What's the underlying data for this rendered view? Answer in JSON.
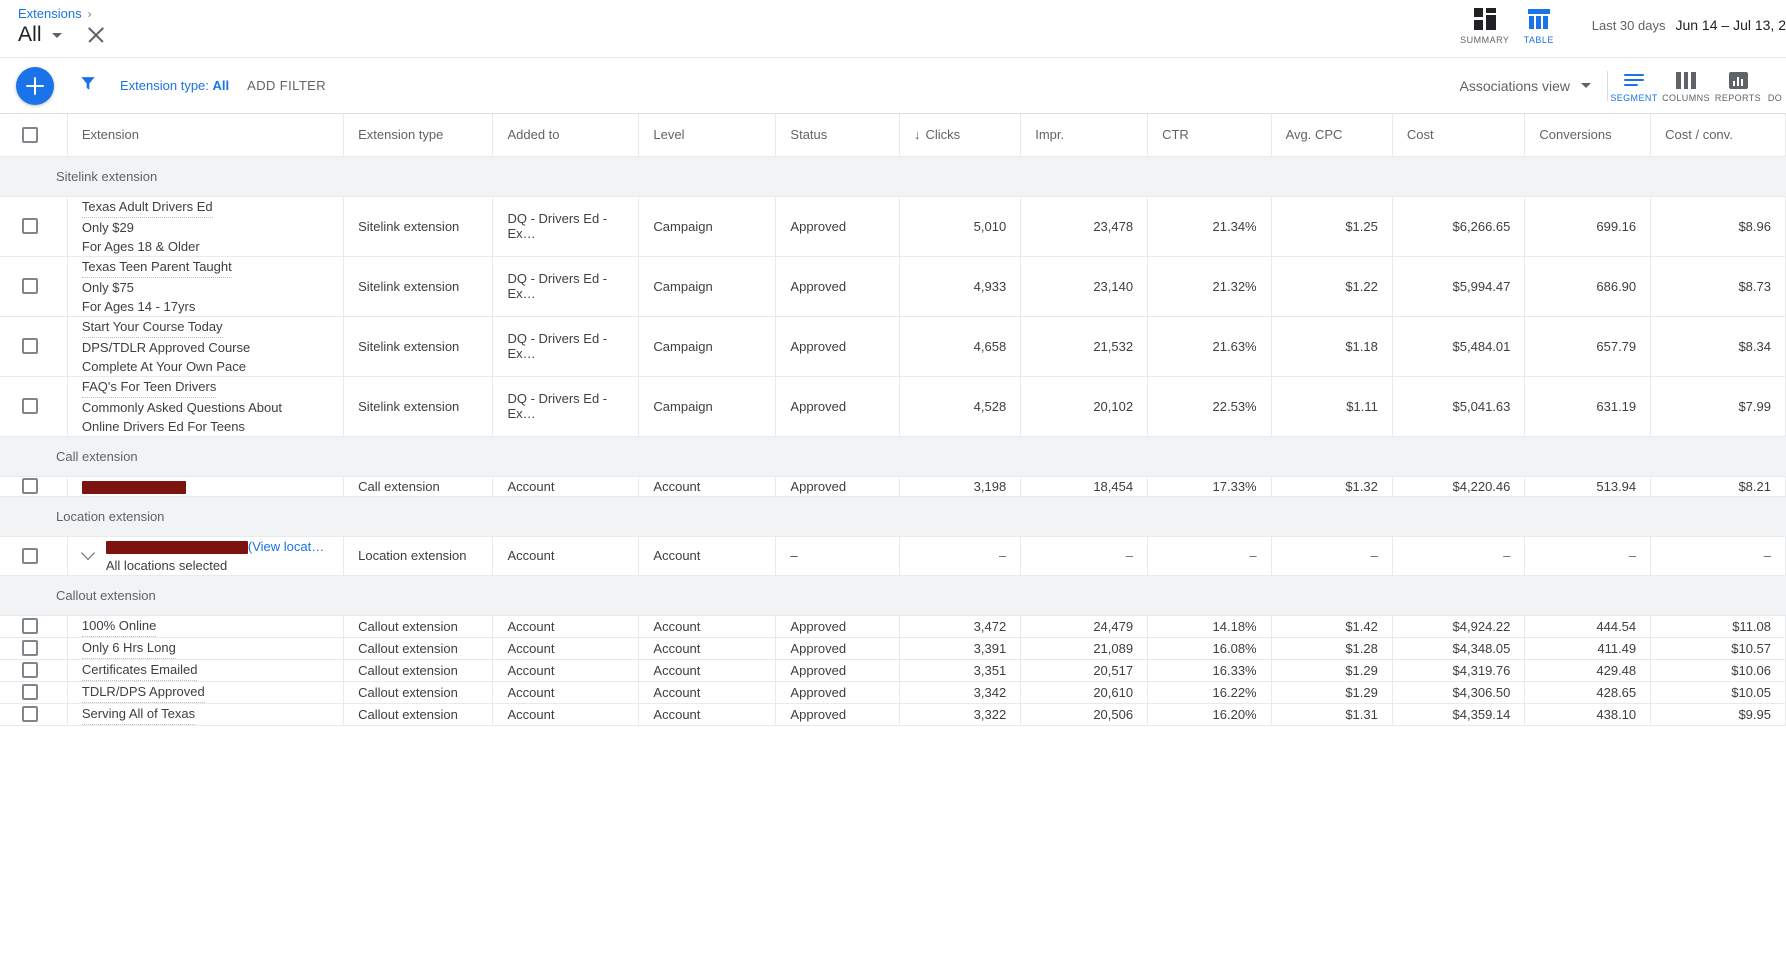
{
  "header": {
    "breadcrumb_link": "Extensions",
    "breadcrumb_separator": "›",
    "scope_label": "All",
    "close_icon": "close-icon",
    "views": [
      {
        "label": "SUMMARY",
        "icon": "summary-grid-icon",
        "active": false
      },
      {
        "label": "TABLE",
        "icon": "table-columns-icon",
        "active": true
      }
    ],
    "date_preset": "Last 30 days",
    "date_value": "Jun 14 – Jul 13, 2"
  },
  "filterbar": {
    "add_button_icon": "plus-icon",
    "filter_icon": "funnel-icon",
    "filter_chip_prefix": "Extension type:",
    "filter_chip_value": "All",
    "add_filter_label": "ADD FILTER",
    "associations_view_label": "Associations view",
    "tools": [
      {
        "label": "SEGMENT",
        "icon": "segment-lines-icon",
        "active": true
      },
      {
        "label": "COLUMNS",
        "icon": "columns-icon",
        "active": false
      },
      {
        "label": "REPORTS",
        "icon": "reports-bar-icon",
        "active": false
      },
      {
        "label": "DO",
        "icon": "download-icon",
        "active": false
      }
    ]
  },
  "table": {
    "select_all_icon": "checkbox-icon",
    "columns": [
      "Extension",
      "Extension type",
      "Added to",
      "Level",
      "Status",
      "Clicks",
      "Impr.",
      "CTR",
      "Avg. CPC",
      "Cost",
      "Conversions",
      "Cost / conv."
    ],
    "sort_column": "Clicks",
    "sort_arrow": "↓",
    "groups": [
      {
        "title": "Sitelink extension",
        "rows": [
          {
            "lines": [
              "Texas Adult Drivers Ed",
              "Only $29",
              "For Ages 18 & Older"
            ],
            "type": "Sitelink extension",
            "added_to": "DQ - Drivers Ed - Ex…",
            "level": "Campaign",
            "status": "Approved",
            "clicks": "5,010",
            "impr": "23,478",
            "ctr": "21.34%",
            "avg_cpc": "$1.25",
            "cost": "$6,266.65",
            "conversions": "699.16",
            "cost_conv": "$8.96"
          },
          {
            "lines": [
              "Texas Teen Parent Taught",
              "Only $75",
              "For Ages 14 - 17yrs"
            ],
            "type": "Sitelink extension",
            "added_to": "DQ - Drivers Ed - Ex…",
            "level": "Campaign",
            "status": "Approved",
            "clicks": "4,933",
            "impr": "23,140",
            "ctr": "21.32%",
            "avg_cpc": "$1.22",
            "cost": "$5,994.47",
            "conversions": "686.90",
            "cost_conv": "$8.73"
          },
          {
            "lines": [
              "Start Your Course Today",
              "DPS/TDLR Approved Course",
              "Complete At Your Own Pace"
            ],
            "type": "Sitelink extension",
            "added_to": "DQ - Drivers Ed - Ex…",
            "level": "Campaign",
            "status": "Approved",
            "clicks": "4,658",
            "impr": "21,532",
            "ctr": "21.63%",
            "avg_cpc": "$1.18",
            "cost": "$5,484.01",
            "conversions": "657.79",
            "cost_conv": "$8.34"
          },
          {
            "lines": [
              "FAQ's For Teen Drivers",
              "Commonly Asked Questions About",
              "Online Drivers Ed For Teens"
            ],
            "type": "Sitelink extension",
            "added_to": "DQ - Drivers Ed - Ex…",
            "level": "Campaign",
            "status": "Approved",
            "clicks": "4,528",
            "impr": "20,102",
            "ctr": "22.53%",
            "avg_cpc": "$1.11",
            "cost": "$5,041.63",
            "conversions": "631.19",
            "cost_conv": "$7.99"
          }
        ]
      },
      {
        "title": "Call extension",
        "rows": [
          {
            "redacted": "phone",
            "lines": [
              ""
            ],
            "type": "Call extension",
            "added_to": "Account",
            "level": "Account",
            "status": "Approved",
            "clicks": "3,198",
            "impr": "18,454",
            "ctr": "17.33%",
            "avg_cpc": "$1.32",
            "cost": "$4,220.46",
            "conversions": "513.94",
            "cost_conv": "$8.21"
          }
        ]
      },
      {
        "title": "Location extension",
        "rows": [
          {
            "redacted": "location",
            "expander_icon": "chevron-down-icon",
            "link_text": "(View locat…",
            "sub_text": "All locations selected",
            "lines": [
              ""
            ],
            "type": "Location extension",
            "added_to": "Account",
            "level": "Account",
            "status": "–",
            "clicks": "–",
            "impr": "–",
            "ctr": "–",
            "avg_cpc": "–",
            "cost": "–",
            "conversions": "–",
            "cost_conv": "–"
          }
        ]
      },
      {
        "title": "Callout extension",
        "rows": [
          {
            "lines": [
              "100% Online"
            ],
            "type": "Callout extension",
            "added_to": "Account",
            "level": "Account",
            "status": "Approved",
            "clicks": "3,472",
            "impr": "24,479",
            "ctr": "14.18%",
            "avg_cpc": "$1.42",
            "cost": "$4,924.22",
            "conversions": "444.54",
            "cost_conv": "$11.08"
          },
          {
            "lines": [
              "Only 6 Hrs Long"
            ],
            "type": "Callout extension",
            "added_to": "Account",
            "level": "Account",
            "status": "Approved",
            "clicks": "3,391",
            "impr": "21,089",
            "ctr": "16.08%",
            "avg_cpc": "$1.28",
            "cost": "$4,348.05",
            "conversions": "411.49",
            "cost_conv": "$10.57"
          },
          {
            "lines": [
              "Certificates Emailed"
            ],
            "type": "Callout extension",
            "added_to": "Account",
            "level": "Account",
            "status": "Approved",
            "clicks": "3,351",
            "impr": "20,517",
            "ctr": "16.33%",
            "avg_cpc": "$1.29",
            "cost": "$4,319.76",
            "conversions": "429.48",
            "cost_conv": "$10.06"
          },
          {
            "lines": [
              "TDLR/DPS Approved"
            ],
            "type": "Callout extension",
            "added_to": "Account",
            "level": "Account",
            "status": "Approved",
            "clicks": "3,342",
            "impr": "20,610",
            "ctr": "16.22%",
            "avg_cpc": "$1.29",
            "cost": "$4,306.50",
            "conversions": "428.65",
            "cost_conv": "$10.05"
          },
          {
            "lines": [
              "Serving All of Texas"
            ],
            "type": "Callout extension",
            "added_to": "Account",
            "level": "Account",
            "status": "Approved",
            "clicks": "3,322",
            "impr": "20,506",
            "ctr": "16.20%",
            "avg_cpc": "$1.31",
            "cost": "$4,359.14",
            "conversions": "438.10",
            "cost_conv": "$9.95"
          }
        ]
      }
    ]
  },
  "colors": {
    "accent": "#1a73e8",
    "group_bg": "#f1f3f4",
    "redaction": "#7c130f",
    "text": "#3c4043"
  }
}
